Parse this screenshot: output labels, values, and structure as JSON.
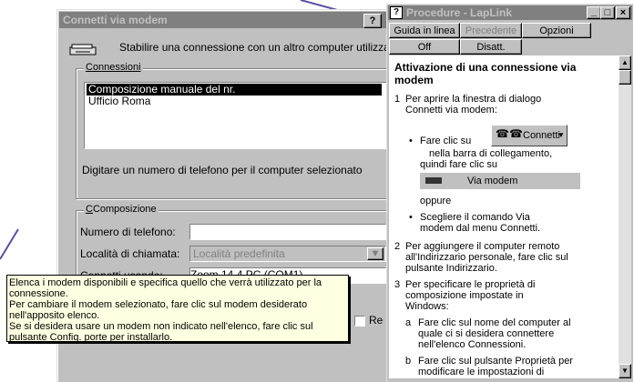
{
  "connect_dialog": {
    "title": "Connetti via modem",
    "help_button": "?",
    "description": "Stabilire una connessione con un altro computer utilizza",
    "connections_group": {
      "label": "Connessioni",
      "items": [
        "Composizione manuale del nr.",
        "Ufficio Roma"
      ],
      "selected_index": 0
    },
    "hint_text": "Digitare un numero di telefono per il computer selezionato",
    "dialing_group": {
      "label": "Composizione",
      "phone_label": "Numero di telefono:",
      "phone_value": "",
      "location_label": "Località di chiamata:",
      "location_value": "Località predefinita",
      "connect_using_label": "Connetti usando:",
      "connect_using_value": "Zoom 14.4 PC (COM1)"
    },
    "checkbox_label_partial": "Re"
  },
  "tooltip": {
    "lines": [
      "Elenca i modem disponibili e specifica quello che verrà utilizzato per la connessione.",
      "Per cambiare il modem selezionato, fare clic sul modem desiderato nell'apposito elenco.",
      "Se si desidera usare un modem non indicato nell'elenco, fare clic sul pulsante Config. porte per installarlo."
    ]
  },
  "help_window": {
    "title": "Procedure - LapLink",
    "buttons": [
      "Guida in linea",
      "Precedente",
      "Opzioni",
      "Off",
      "Disatt."
    ],
    "heading": "Attivazione di una connessione via modem",
    "step1": "Per aprire la finestra di dialogo Connetti via modem:",
    "bullet_click": "Fare clic su",
    "connect_toolbar_label": "Connetti",
    "bullet_click_cont": "nella barra di collegamento, quindi fare clic su",
    "via_modem_label": "Via modem",
    "or_text": "oppure",
    "bullet_menu": "Scegliere il comando Via modem dal menu Connetti.",
    "step2": "Per aggiungere il computer remoto all'Indirizzario personale, fare clic sul pulsante Indirizzario.",
    "step3": "Per specificare le proprietà di composizione impostate in Windows:",
    "sub_a": "Fare clic sul nome del computer al quale ci si desidera connettere nell'elenco Connessioni.",
    "sub_b": "Fare clic sul pulsante Proprietà per modificare le impostazioni di",
    "num1": "1",
    "num2": "2",
    "num3": "3",
    "suba": "a",
    "subb": "b"
  },
  "colors": {
    "title_active": "#000080",
    "title_inactive": "#808080",
    "face": "#c0c0c0",
    "tooltip_bg": "#ffffe1",
    "arrow_line": "#5a4fa0"
  }
}
